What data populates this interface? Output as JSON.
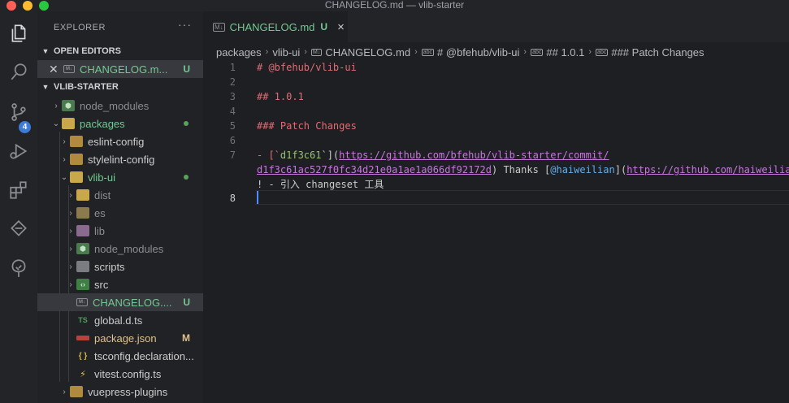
{
  "window": {
    "title": "CHANGELOG.md — vlib-starter"
  },
  "activity": {
    "scm_badge": "4"
  },
  "explorer": {
    "header": "EXPLORER",
    "more": "···",
    "open_editors": {
      "title": "OPEN EDITORS",
      "item": {
        "label": "CHANGELOG.m...",
        "status": "U"
      }
    },
    "project": {
      "title": "VLIB-STARTER",
      "items": [
        {
          "label": "node_modules"
        },
        {
          "label": "packages"
        },
        {
          "label": "eslint-config"
        },
        {
          "label": "stylelint-config"
        },
        {
          "label": "vlib-ui"
        },
        {
          "label": "dist"
        },
        {
          "label": "es"
        },
        {
          "label": "lib"
        },
        {
          "label": "node_modules"
        },
        {
          "label": "scripts"
        },
        {
          "label": "src"
        },
        {
          "label": "CHANGELOG....",
          "status": "U"
        },
        {
          "label": "global.d.ts",
          "icon_text": "TS"
        },
        {
          "label": "package.json",
          "status": "M"
        },
        {
          "label": "tsconfig.declaration...",
          "icon_text": "{ }"
        },
        {
          "label": "vitest.config.ts"
        },
        {
          "label": "vuepress-plugins"
        }
      ]
    }
  },
  "tab": {
    "label": "CHANGELOG.md",
    "status": "U",
    "icon_text": "M↓"
  },
  "breadcrumb": {
    "items": [
      "packages",
      "vlib-ui",
      "CHANGELOG.md",
      "# @bfehub/vlib-ui",
      "## 1.0.1",
      "### Patch Changes"
    ]
  },
  "editor": {
    "line_numbers": [
      "1",
      "2",
      "3",
      "4",
      "5",
      "6",
      "7",
      "",
      "",
      "8"
    ],
    "line1": "# @bfehub/vlib-ui",
    "line3": "## 1.0.1",
    "line5": "### Patch Changes",
    "line7": {
      "p1": "- [`",
      "code": "d1f3c61",
      "p2": "`](",
      "url1": "https://github.com/bfehub/vlib-starter/commit/",
      "url1b": "d1f3c61ac527f0fc34d21e0a1ae1a066df92172d",
      "p3": ")",
      "thanks": " Thanks [",
      "user": "@haiweilian",
      "p4": "](",
      "url2": "https://github.com/haiweilia",
      "rest": "! - 引入 changeset 工具"
    }
  },
  "colors": {
    "accent": "#528bff",
    "untracked": "#73c991",
    "modified": "#e2c08d",
    "heading": "#e06c75",
    "link_url": "#c678dd"
  }
}
